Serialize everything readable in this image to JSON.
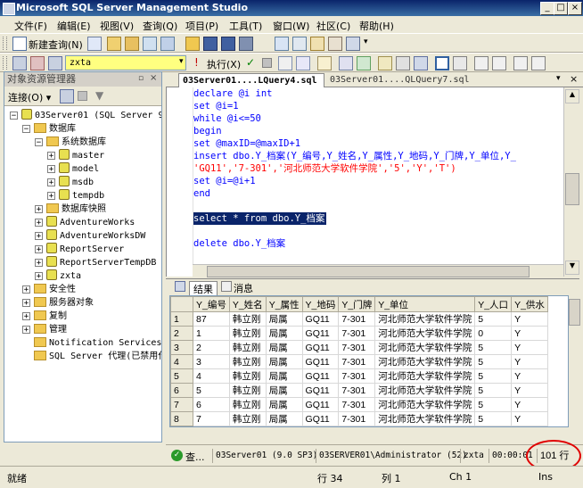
{
  "window": {
    "title": "Microsoft SQL Server Management Studio"
  },
  "menu": [
    "文件(F)",
    "编辑(E)",
    "视图(V)",
    "查询(Q)",
    "项目(P)",
    "工具(T)",
    "窗口(W)",
    "社区(C)",
    "帮助(H)"
  ],
  "toolbar1": {
    "new_query": "新建查询(N)"
  },
  "toolbar2": {
    "database": "zxta",
    "execute": "执行(X)"
  },
  "object_explorer": {
    "title": "对象资源管理器",
    "connect": "连接(O) ▾",
    "items": [
      {
        "label": "03Server01 (SQL Server 9.0.4",
        "level": 0,
        "pm": "-"
      },
      {
        "label": "数据库",
        "level": 1,
        "pm": "-"
      },
      {
        "label": "系统数据库",
        "level": 2,
        "pm": "-"
      },
      {
        "label": "master",
        "level": 3,
        "pm": "+"
      },
      {
        "label": "model",
        "level": 3,
        "pm": "+"
      },
      {
        "label": "msdb",
        "level": 3,
        "pm": "+"
      },
      {
        "label": "tempdb",
        "level": 3,
        "pm": "+"
      },
      {
        "label": "数据库快照",
        "level": 2,
        "pm": "+"
      },
      {
        "label": "AdventureWorks",
        "level": 2,
        "pm": "+"
      },
      {
        "label": "AdventureWorksDW",
        "level": 2,
        "pm": "+"
      },
      {
        "label": "ReportServer",
        "level": 2,
        "pm": "+"
      },
      {
        "label": "ReportServerTempDB",
        "level": 2,
        "pm": "+"
      },
      {
        "label": "zxta",
        "level": 2,
        "pm": "+"
      },
      {
        "label": "安全性",
        "level": 1,
        "pm": "+"
      },
      {
        "label": "服务器对象",
        "level": 1,
        "pm": "+"
      },
      {
        "label": "复制",
        "level": 1,
        "pm": "+"
      },
      {
        "label": "管理",
        "level": 1,
        "pm": "+"
      },
      {
        "label": "Notification Services",
        "level": 1,
        "pm": ""
      },
      {
        "label": "SQL Server 代理(已禁用代理",
        "level": 1,
        "pm": ""
      }
    ]
  },
  "tabs": [
    "03Server01....LQuery4.sql",
    "03Server01....QLQuery7.sql"
  ],
  "code": {
    "l1": "declare @i int",
    "l2": "set @i=1",
    "l3": "while @i<=50",
    "l4": "begin",
    "l5": "set @maxID=@maxID+1",
    "l6a": "insert dbo.Y_档案(Y_编号,Y_姓名,Y_属性,Y_地码,Y_门牌,Y_单位,Y_",
    "l7a": "'GQ11','7-301',",
    "l7b": "'河北师范大学软件学院'",
    "l7c": ",'5','Y','T')",
    "l8": "set @i=@i+1",
    "l9": "end",
    "l10": "select * from dbo.Y_档案",
    "l11": "delete dbo.Y_档案"
  },
  "result_tabs": {
    "results": "结果",
    "messages": "消息"
  },
  "grid": {
    "columns": [
      "Y_编号",
      "Y_姓名",
      "Y_属性",
      "Y_地码",
      "Y_门牌",
      "Y_单位",
      "Y_人口",
      "Y_供水"
    ],
    "rows": [
      [
        "1",
        "87",
        "韩立刚",
        "局属",
        "GQ11",
        "7-301",
        "河北师范大学软件学院",
        "5",
        "Y"
      ],
      [
        "2",
        "1",
        "韩立刚",
        "局属",
        "GQ11",
        "7-301",
        "河北师范大学软件学院",
        "0",
        "Y"
      ],
      [
        "3",
        "2",
        "韩立刚",
        "局属",
        "GQ11",
        "7-301",
        "河北师范大学软件学院",
        "5",
        "Y"
      ],
      [
        "4",
        "3",
        "韩立刚",
        "局属",
        "GQ11",
        "7-301",
        "河北师范大学软件学院",
        "5",
        "Y"
      ],
      [
        "5",
        "4",
        "韩立刚",
        "局属",
        "GQ11",
        "7-301",
        "河北师范大学软件学院",
        "5",
        "Y"
      ],
      [
        "6",
        "5",
        "韩立刚",
        "局属",
        "GQ11",
        "7-301",
        "河北师范大学软件学院",
        "5",
        "Y"
      ],
      [
        "7",
        "6",
        "韩立刚",
        "局属",
        "GQ11",
        "7-301",
        "河北师范大学软件学院",
        "5",
        "Y"
      ],
      [
        "8",
        "7",
        "韩立刚",
        "局属",
        "GQ11",
        "7-301",
        "河北师范大学软件学院",
        "5",
        "Y"
      ]
    ]
  },
  "query_status": {
    "state": "查...",
    "server": "03Server01 (9.0 SP3)",
    "user": "03SERVER01\\Administrator (52)",
    "db": "zxta",
    "time": "00:00:01",
    "rows": "101 行"
  },
  "statusbar": {
    "ready": "就绪",
    "line": "行 34",
    "col": "列 1",
    "ch": "Ch 1",
    "ins": "Ins"
  },
  "colors": {
    "highlight": "#0a246a",
    "annotation": "#e00000"
  }
}
